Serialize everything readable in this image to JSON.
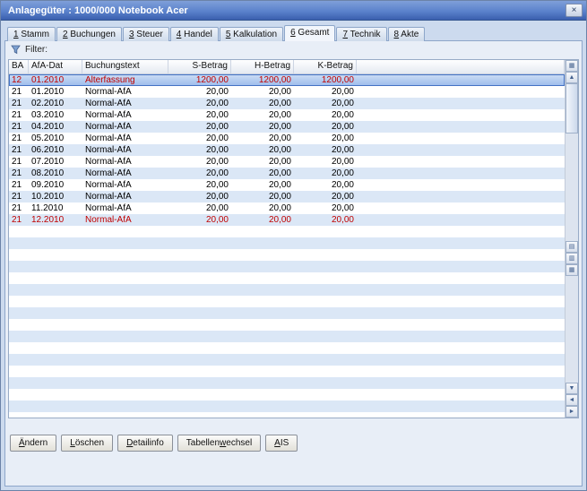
{
  "window": {
    "title": "Anlagegüter : 1000/000 Notebook Acer"
  },
  "colors": {
    "titlebar_top": "#7f9fd9",
    "titlebar_bottom": "#3a5fae",
    "row_stripe": "#dbe7f6",
    "selection": "#9cbcec",
    "alert_text": "#c00000"
  },
  "icons": {
    "close": "×",
    "grid": "▦",
    "up": "▲",
    "down": "▼",
    "left": "◄",
    "right": "►",
    "marker1": "▤",
    "marker2": "▥",
    "marker3": "▦",
    "filter": "funnel-icon"
  },
  "tabs": [
    {
      "id": "stamm",
      "hotkey": "1",
      "label": "Stamm",
      "active": false
    },
    {
      "id": "buchungen",
      "hotkey": "2",
      "label": "Buchungen",
      "active": false
    },
    {
      "id": "steuer",
      "hotkey": "3",
      "label": "Steuer",
      "active": false
    },
    {
      "id": "handel",
      "hotkey": "4",
      "label": "Handel",
      "active": false
    },
    {
      "id": "kalkulation",
      "hotkey": "5",
      "label": "Kalkulation",
      "active": false
    },
    {
      "id": "gesamt",
      "hotkey": "6",
      "label": "Gesamt",
      "active": true
    },
    {
      "id": "technik",
      "hotkey": "7",
      "label": "Technik",
      "active": false
    },
    {
      "id": "akte",
      "hotkey": "8",
      "label": "Akte",
      "active": false
    }
  ],
  "filter": {
    "label": "Filter:"
  },
  "table": {
    "columns": [
      "BA",
      "AfA-Dat",
      "Buchungstext",
      "S-Betrag",
      "H-Betrag",
      "K-Betrag",
      ""
    ],
    "rows": [
      {
        "ba": "12",
        "date": "01.2010",
        "text": "Alterfassung",
        "s": "1200,00",
        "h": "1200,00",
        "k": "1200,00",
        "selected": true,
        "red": true
      },
      {
        "ba": "21",
        "date": "01.2010",
        "text": "Normal-AfA",
        "s": "20,00",
        "h": "20,00",
        "k": "20,00"
      },
      {
        "ba": "21",
        "date": "02.2010",
        "text": "Normal-AfA",
        "s": "20,00",
        "h": "20,00",
        "k": "20,00"
      },
      {
        "ba": "21",
        "date": "03.2010",
        "text": "Normal-AfA",
        "s": "20,00",
        "h": "20,00",
        "k": "20,00"
      },
      {
        "ba": "21",
        "date": "04.2010",
        "text": "Normal-AfA",
        "s": "20,00",
        "h": "20,00",
        "k": "20,00"
      },
      {
        "ba": "21",
        "date": "05.2010",
        "text": "Normal-AfA",
        "s": "20,00",
        "h": "20,00",
        "k": "20,00"
      },
      {
        "ba": "21",
        "date": "06.2010",
        "text": "Normal-AfA",
        "s": "20,00",
        "h": "20,00",
        "k": "20,00"
      },
      {
        "ba": "21",
        "date": "07.2010",
        "text": "Normal-AfA",
        "s": "20,00",
        "h": "20,00",
        "k": "20,00"
      },
      {
        "ba": "21",
        "date": "08.2010",
        "text": "Normal-AfA",
        "s": "20,00",
        "h": "20,00",
        "k": "20,00"
      },
      {
        "ba": "21",
        "date": "09.2010",
        "text": "Normal-AfA",
        "s": "20,00",
        "h": "20,00",
        "k": "20,00"
      },
      {
        "ba": "21",
        "date": "10.2010",
        "text": "Normal-AfA",
        "s": "20,00",
        "h": "20,00",
        "k": "20,00"
      },
      {
        "ba": "21",
        "date": "11.2010",
        "text": "Normal-AfA",
        "s": "20,00",
        "h": "20,00",
        "k": "20,00"
      },
      {
        "ba": "21",
        "date": "12.2010",
        "text": "Normal-AfA",
        "s": "20,00",
        "h": "20,00",
        "k": "20,00",
        "red": true
      }
    ]
  },
  "buttons": [
    {
      "id": "aendern",
      "pre": "",
      "hotkey": "Ä",
      "post": "ndern"
    },
    {
      "id": "loeschen",
      "pre": "",
      "hotkey": "L",
      "post": "öschen"
    },
    {
      "id": "detailinfo",
      "pre": "",
      "hotkey": "D",
      "post": "etailinfo"
    },
    {
      "id": "tabellenwechsel",
      "pre": "Tabellen",
      "hotkey": "w",
      "post": "echsel"
    },
    {
      "id": "ais",
      "pre": "",
      "hotkey": "A",
      "post": "IS"
    }
  ]
}
